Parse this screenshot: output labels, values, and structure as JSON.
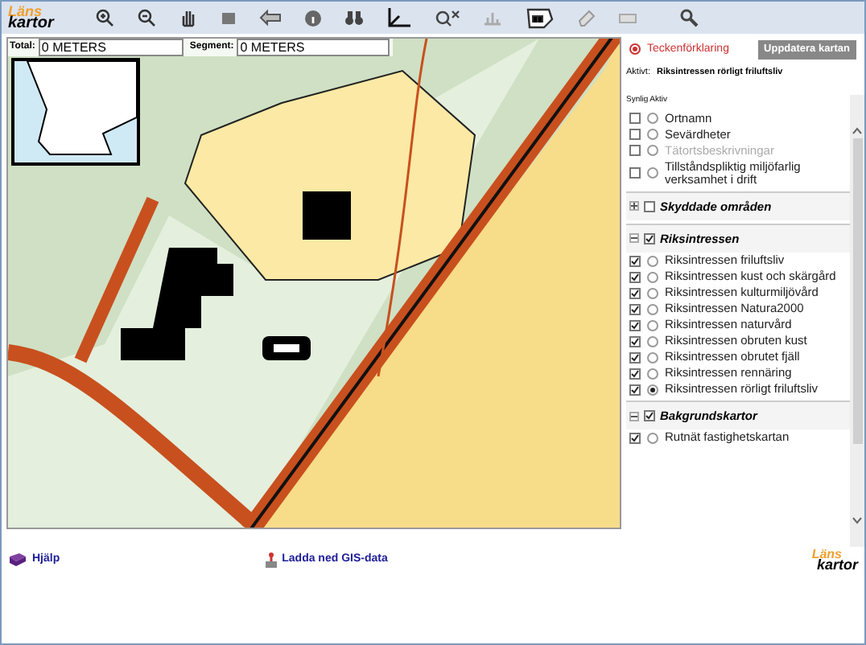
{
  "logo": {
    "top": "Läns",
    "bottom": "kartor"
  },
  "measure": {
    "total_label": "Total:",
    "total_value": "0 METERS",
    "segment_label": "Segment:",
    "segment_value": "0 METERS"
  },
  "legend": {
    "label": "Teckenförklaring",
    "update_button": "Uppdatera kartan",
    "active_label": "Aktivt:",
    "active_value": "Riksintressen rörligt friluftsliv"
  },
  "columns": {
    "visible": "Synlig",
    "active": "Aktiv"
  },
  "layers": [
    {
      "kind": "layer",
      "label": "Ortnamn",
      "visible": false,
      "selected": false,
      "disabled": false
    },
    {
      "kind": "layer",
      "label": "Sevärdheter",
      "visible": false,
      "selected": false,
      "disabled": false
    },
    {
      "kind": "layer",
      "label": "Tätortsbeskrivningar",
      "visible": false,
      "selected": false,
      "disabled": true
    },
    {
      "kind": "layer",
      "label": "Tillståndspliktig miljöfarlig verksamhet i drift",
      "visible": false,
      "selected": false,
      "disabled": false
    },
    {
      "kind": "group",
      "label": "Skyddade områden",
      "expanded": false,
      "checked": false
    },
    {
      "kind": "group",
      "label": "Riksintressen",
      "expanded": true,
      "checked": true
    },
    {
      "kind": "layer",
      "label": "Riksintressen friluftsliv",
      "visible": true,
      "selected": false,
      "disabled": false
    },
    {
      "kind": "layer",
      "label": "Riksintressen kust och skärgård",
      "visible": true,
      "selected": false,
      "disabled": false
    },
    {
      "kind": "layer",
      "label": "Riksintressen kulturmiljövård",
      "visible": true,
      "selected": false,
      "disabled": false
    },
    {
      "kind": "layer",
      "label": "Riksintressen Natura2000",
      "visible": true,
      "selected": false,
      "disabled": false
    },
    {
      "kind": "layer",
      "label": "Riksintressen naturvård",
      "visible": true,
      "selected": false,
      "disabled": false
    },
    {
      "kind": "layer",
      "label": "Riksintressen obruten kust",
      "visible": true,
      "selected": false,
      "disabled": false
    },
    {
      "kind": "layer",
      "label": "Riksintressen obrutet fjäll",
      "visible": true,
      "selected": false,
      "disabled": false
    },
    {
      "kind": "layer",
      "label": "Riksintressen rennäring",
      "visible": true,
      "selected": false,
      "disabled": false
    },
    {
      "kind": "layer",
      "label": "Riksintressen rörligt friluftsliv",
      "visible": true,
      "selected": true,
      "disabled": false
    },
    {
      "kind": "group",
      "label": "Bakgrundskartor",
      "expanded": true,
      "checked": true
    },
    {
      "kind": "layer",
      "label": "Rutnät fastighetskartan",
      "visible": true,
      "selected": false,
      "disabled": false
    }
  ],
  "footer": {
    "help": "Hjälp",
    "download": "Ladda ned GIS-data",
    "logo_top": "Läns",
    "logo_bottom": "kartor"
  }
}
